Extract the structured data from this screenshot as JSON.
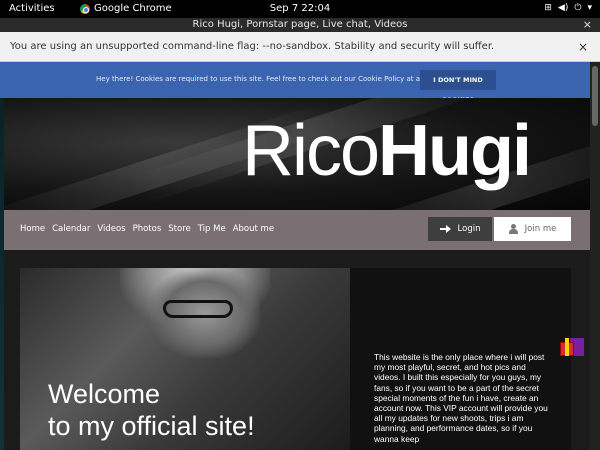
{
  "system_bar": {
    "activities": "Activities",
    "app_name": "Google Chrome",
    "clock": "Sep 7  22:04"
  },
  "window": {
    "title": "Rico Hugi, Pornstar page, Live chat, Videos",
    "close_glyph": "×"
  },
  "infobar": {
    "message": "You are using an unsupported command-line flag: --no-sandbox. Stability and security will suffer.",
    "close_glyph": "×"
  },
  "cookie_bar": {
    "message": "Hey there! Cookies are required to use this site. Feel free to check out our Cookie Policy at any time.",
    "button": "I DON'T MIND COOKIES",
    "color": "#3a64b0"
  },
  "brand": {
    "first": "Rico",
    "last": "Hugi"
  },
  "nav": {
    "items": [
      "Home",
      "Calendar",
      "Videos",
      "Photos",
      "Store",
      "Tip Me",
      "About me"
    ],
    "login": "Login",
    "join": "Join me"
  },
  "hero": {
    "line1": "Welcome",
    "line2": "to my official site!"
  },
  "intro": {
    "text": "This website is the only place where i will post my most playful, secret, and hot pics and videos. I built this especially for you guys, my fans, so if you want to be a part of the secret special moments of the fun i have, create an account now. This VIP account will provide you all my updates for new shoots, trips i am planning, and performance dates, so if you wanna keep"
  }
}
